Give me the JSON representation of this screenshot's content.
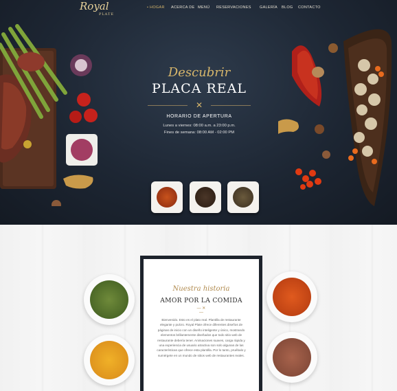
{
  "brand": {
    "script": "Royal",
    "sub": "PLATE",
    "top": "The"
  },
  "nav": {
    "items": [
      {
        "label": "• HOGAR",
        "active": true
      },
      {
        "label": "ACERCA DE"
      },
      {
        "label": "MENÚ"
      },
      {
        "label": "RESERVACIONES"
      },
      {
        "label": "GALERÍA"
      },
      {
        "label": "BLOG"
      },
      {
        "label": "CONTACTO"
      }
    ]
  },
  "hero": {
    "kicker": "Descubrir",
    "title": "PLACA REAL",
    "hours_title": "HORARIO DE APERTURA",
    "hours_line1": "Lunes a viernes: 08:00 a.m. a 23:00 p.m.",
    "hours_line2": "Fines de semana: 08:00 AM - 02:00 PM"
  },
  "story": {
    "kicker": "Nuestra historia",
    "title": "AMOR POR LA COMIDA",
    "body": "Bienvenido. Esto es el plato real. Plantilla de restaurante elegante y pulcro. Royal Plate ofrece diferentes diseños de páginas de inicio con un diseño inteligente y único, mostrando elementos brillantemente diseñados que todo sitio web de restaurante debería tener. Animaciones suaves, carga rápida y una experiencia de usuario atractiva son solo algunas de las características que ofrece esta plantilla. Por lo tanto, pruébalo y sumérgete en un mundo de sitios web de restaurantes reales."
  },
  "colors": {
    "accent": "#d7b66b",
    "hero_bg": "#1d2633",
    "card_border": "#1d232c"
  }
}
